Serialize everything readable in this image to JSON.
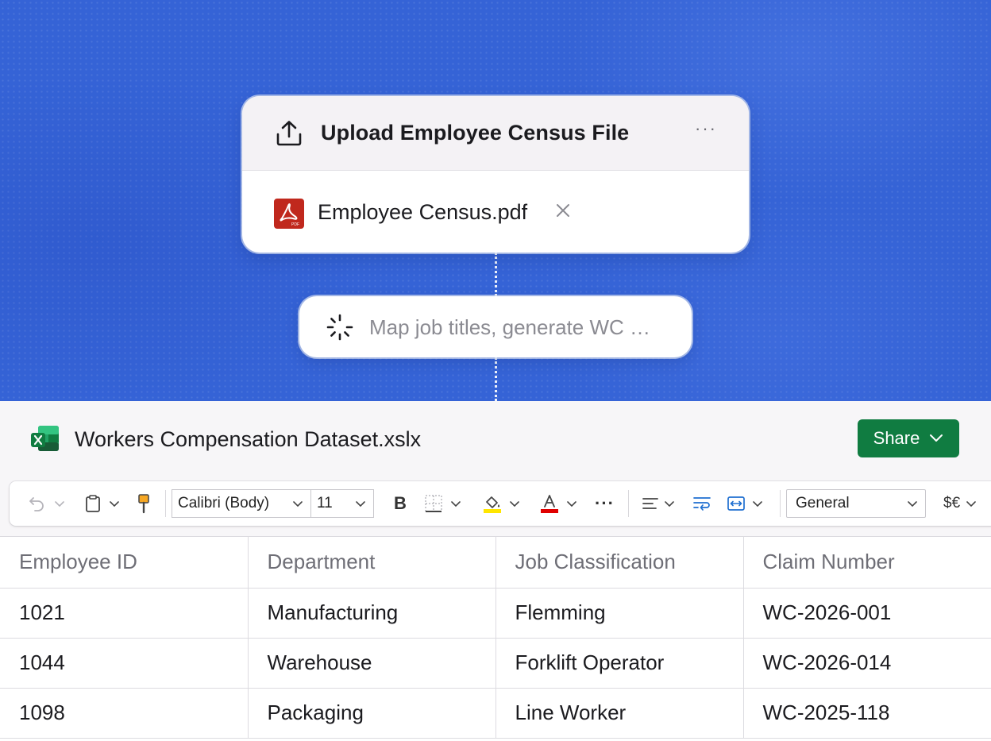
{
  "workflow": {
    "upload_card": {
      "title": "Upload Employee Census File",
      "more_label": "···",
      "file_name": "Employee Census.pdf",
      "file_icon": "pdf-icon",
      "icon": "upload-icon"
    },
    "task": {
      "text": "Map job titles, generate WC …",
      "icon": "spinner-icon"
    }
  },
  "spreadsheet": {
    "file_title": "Workers Compensation Dataset.xslx",
    "app_icon": "excel-icon",
    "share_label": "Share",
    "toolbar": {
      "font_family": "Calibri (Body)",
      "font_size": "11",
      "bold_label": "B",
      "number_format": "General",
      "currency_label": "$€",
      "more_label": "···"
    },
    "columns": [
      "Employee ID",
      "Department",
      "Job Classification",
      "Claim Number"
    ],
    "rows": [
      [
        "1021",
        "Manufacturing",
        "Flemming",
        "WC-2026-001"
      ],
      [
        "1044",
        "Warehouse",
        "Forklift Operator",
        "WC-2026-014"
      ],
      [
        "1098",
        "Packaging",
        "Line Worker",
        "WC-2025-118"
      ]
    ]
  },
  "colors": {
    "hero_blue": "#3563d6",
    "excel_green": "#107c41",
    "pdf_red": "#c0281d"
  }
}
